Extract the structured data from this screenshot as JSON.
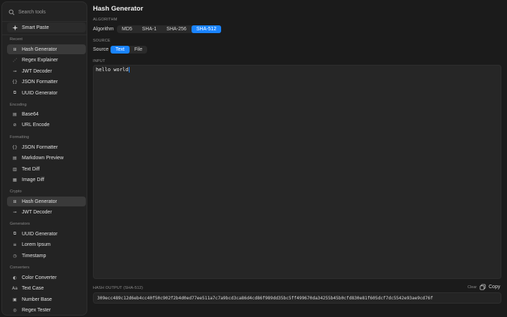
{
  "search": {
    "placeholder": "Search tools",
    "icon": "search-icon"
  },
  "smart_paste": {
    "label": "Smart Paste",
    "icon": "sparkle-icon"
  },
  "sections": {
    "recent": "Recent",
    "encoding": "Encoding",
    "formatting": "Formatting",
    "crypto": "Crypto",
    "generators": "Generators",
    "converters": "Converters"
  },
  "sidebar": {
    "recent": [
      {
        "label": "Hash Generator",
        "icon": "hash-icon",
        "glyph": "⊞"
      },
      {
        "label": "Regex Explainer",
        "icon": "regex-icon",
        "glyph": "⋰"
      },
      {
        "label": "JWT Decoder",
        "icon": "key-icon",
        "glyph": "⊸"
      },
      {
        "label": "JSON Formatter",
        "icon": "braces-icon",
        "glyph": "{}"
      },
      {
        "label": "UUID Generator",
        "icon": "copy-icon",
        "glyph": "⧉"
      }
    ],
    "encoding": [
      {
        "label": "Base64",
        "icon": "file-icon",
        "glyph": "▤"
      },
      {
        "label": "URL Encode",
        "icon": "link-icon",
        "glyph": "⊘"
      }
    ],
    "formatting": [
      {
        "label": "JSON Formatter",
        "icon": "braces-icon",
        "glyph": "{}"
      },
      {
        "label": "Markdown Preview",
        "icon": "document-icon",
        "glyph": "▤"
      },
      {
        "label": "Text Diff",
        "icon": "diff-icon",
        "glyph": "▥"
      },
      {
        "label": "Image Diff",
        "icon": "image-icon",
        "glyph": "▦"
      }
    ],
    "crypto": [
      {
        "label": "Hash Generator",
        "icon": "hash-icon",
        "glyph": "⊞"
      },
      {
        "label": "JWT Decoder",
        "icon": "key-icon",
        "glyph": "⊸"
      }
    ],
    "generators": [
      {
        "label": "UUID Generator",
        "icon": "copy-icon",
        "glyph": "⧉"
      },
      {
        "label": "Lorem Ipsum",
        "icon": "text-lines-icon",
        "glyph": "≡"
      },
      {
        "label": "Timestamp",
        "icon": "clock-icon",
        "glyph": "◷"
      }
    ],
    "converters": [
      {
        "label": "Color Converter",
        "icon": "palette-icon",
        "glyph": "◐"
      },
      {
        "label": "Text Case",
        "icon": "text-case-icon",
        "glyph": "Aa"
      },
      {
        "label": "Number Base",
        "icon": "number-icon",
        "glyph": "▣"
      },
      {
        "label": "Regex Tester",
        "icon": "target-icon",
        "glyph": "◎"
      }
    ]
  },
  "main": {
    "title": "Hash Generator",
    "algorithm_section": "ALGORITHM",
    "algorithm_label": "Algorithm",
    "algorithms": [
      "MD5",
      "SHA-1",
      "SHA-256",
      "SHA-512"
    ],
    "algorithm_selected": "SHA-512",
    "source_section": "SOURCE",
    "source_label": "Source",
    "sources": [
      "Text",
      "File"
    ],
    "source_selected": "Text",
    "input_section": "INPUT",
    "input_value": "hello world",
    "output_section": "HASH OUTPUT (SHA-512)",
    "clear_label": "Clear",
    "copy_label": "Copy",
    "output_value": "309ecc489c12d6eb4cc40f50c902f2b4d0ed77ee511a7c7a9bcd3ca86d4cd86f989dd35bc5ff499670da34255b45b0cfd830e81f605dcf7dc5542e93ae9cd76f"
  },
  "colors": {
    "accent": "#1a84ff",
    "background": "#1b1b1b",
    "sidebar": "#232323",
    "active_item": "#3a3a3a"
  }
}
